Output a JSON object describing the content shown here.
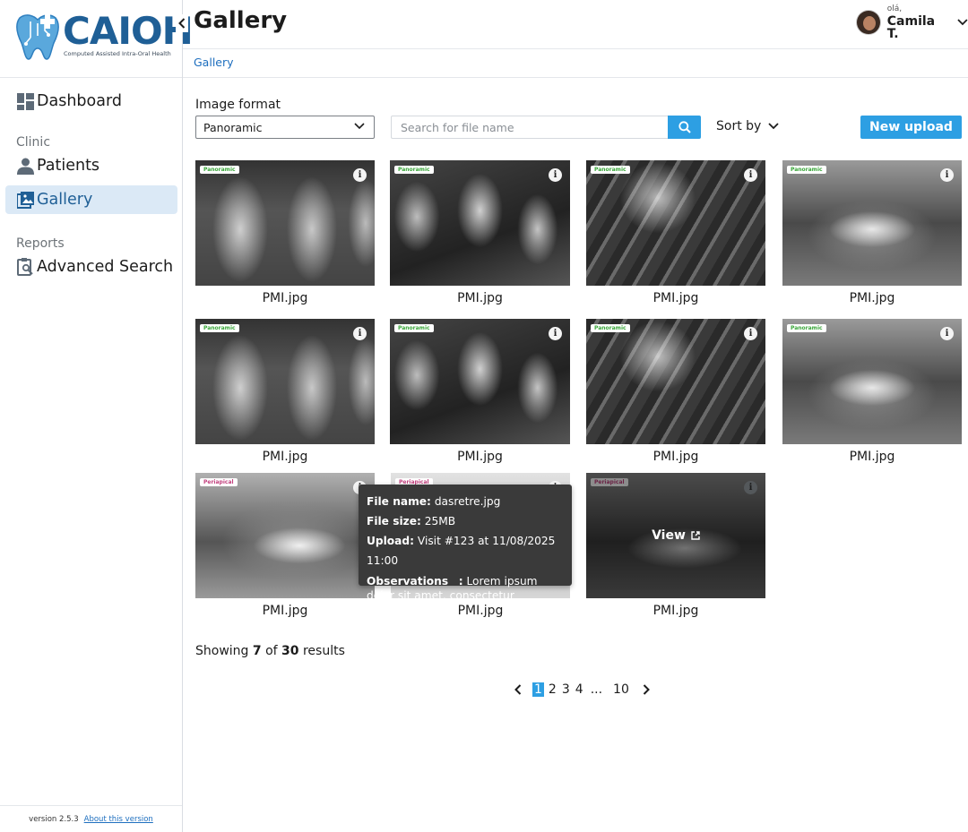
{
  "brand": {
    "name": "CAIOH",
    "tagline": "Computed Assisted Intra-Oral Health"
  },
  "sidebar": {
    "dashboard": "Dashboard",
    "section_clinic": "Clinic",
    "patients": "Patients",
    "gallery": "Gallery",
    "section_reports": "Reports",
    "advanced_search": "Advanced Search",
    "footer_version": "version 2.5.3",
    "footer_about": "About this version"
  },
  "header": {
    "title": "Gallery",
    "greeting": "olá,",
    "user_name": "Camila T."
  },
  "breadcrumb": "Gallery",
  "filters": {
    "format_label": "Image format",
    "format_value": "Panoramic",
    "search_placeholder": "Search for file name",
    "sort_label": "Sort by",
    "upload_label": "New upload"
  },
  "gallery": {
    "tag_panoramic": "Panoramic",
    "tag_periapical": "Periapical",
    "view_label": "View",
    "items": [
      {
        "caption": "PMI.jpg",
        "tag": "Panoramic"
      },
      {
        "caption": "PMI.jpg",
        "tag": "Panoramic"
      },
      {
        "caption": "PMI.jpg",
        "tag": "Panoramic"
      },
      {
        "caption": "PMI.jpg",
        "tag": "Panoramic"
      },
      {
        "caption": "PMI.jpg",
        "tag": "Panoramic"
      },
      {
        "caption": "PMI.jpg",
        "tag": "Panoramic"
      },
      {
        "caption": "PMI.jpg",
        "tag": "Panoramic"
      },
      {
        "caption": "PMI.jpg",
        "tag": "Panoramic"
      },
      {
        "caption": "PMI.jpg",
        "tag": "Periapical"
      },
      {
        "caption": "PMI.jpg",
        "tag": "Periapical"
      },
      {
        "caption": "PMI.jpg",
        "tag": "Periapical"
      }
    ]
  },
  "tooltip": {
    "file_name_label": "File name:",
    "file_name": "dasretre.jpg",
    "file_size_label": "File size:",
    "file_size": "25MB",
    "upload_label": "Upload:",
    "upload_value": "Visit #123 at 11/08/2025 11:00",
    "observations_label": "Observations",
    "observations_sep": ":",
    "observations": "Lorem ipsum dolor sit amet, consectetur adipiscing elit."
  },
  "results": {
    "prefix": "Showing",
    "shown": "7",
    "of": "of",
    "total": "30",
    "suffix": "results"
  },
  "pagination": {
    "pages": [
      "1",
      "2",
      "3",
      "4"
    ],
    "ellipsis": "...",
    "last": "10",
    "current": "1"
  },
  "colors": {
    "accent": "#2d9fe3",
    "brand": "#1f5f96",
    "active_bg": "#dbe9f6",
    "tag_pano": "#3aa63a",
    "tag_peri": "#c2407e"
  }
}
